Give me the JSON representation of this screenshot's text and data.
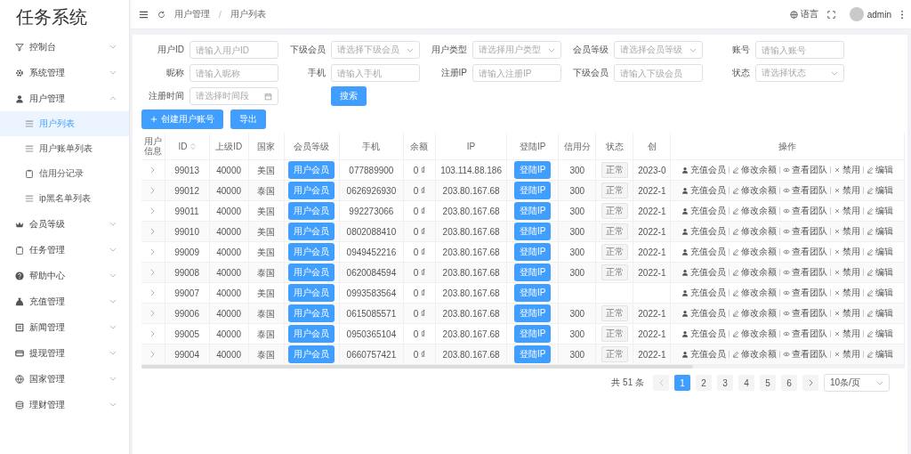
{
  "app_title": "任务系统",
  "sidebar": {
    "items": [
      {
        "label": "控制台",
        "expanded": false,
        "selected": false
      },
      {
        "label": "系统管理",
        "expanded": false,
        "selected": false
      },
      {
        "label": "用户管理",
        "expanded": true,
        "selected": false,
        "children": [
          {
            "label": "用户列表",
            "selected": true
          },
          {
            "label": "用户账单列表",
            "selected": false
          },
          {
            "label": "信用分记录",
            "selected": false
          },
          {
            "label": "ip黑名单列表",
            "selected": false
          }
        ]
      },
      {
        "label": "会员等级",
        "expanded": false,
        "selected": false
      },
      {
        "label": "任务管理",
        "expanded": false,
        "selected": false
      },
      {
        "label": "帮助中心",
        "expanded": false,
        "selected": false
      },
      {
        "label": "充值管理",
        "expanded": false,
        "selected": false
      },
      {
        "label": "新闻管理",
        "expanded": false,
        "selected": false
      },
      {
        "label": "提现管理",
        "expanded": false,
        "selected": false
      },
      {
        "label": "国家管理",
        "expanded": false,
        "selected": false
      },
      {
        "label": "理财管理",
        "expanded": false,
        "selected": false
      }
    ]
  },
  "header": {
    "breadcrumb": [
      "用户管理",
      "用户列表"
    ],
    "separator": "/",
    "language": "语言",
    "user": "admin"
  },
  "filters": [
    {
      "label": "用户ID",
      "placeholder": "请输入用户ID",
      "kind": "input"
    },
    {
      "label": "下级会员",
      "placeholder": "请选择下级会员",
      "kind": "select"
    },
    {
      "label": "用户类型",
      "placeholder": "请选择用户类型",
      "kind": "select"
    },
    {
      "label": "会员等级",
      "placeholder": "请选择会员等级",
      "kind": "select"
    },
    {
      "label": "账号",
      "placeholder": "请输入账号",
      "kind": "input"
    },
    {
      "label": "昵称",
      "placeholder": "请输入昵称",
      "kind": "input"
    },
    {
      "label": "手机",
      "placeholder": "请输入手机",
      "kind": "input"
    },
    {
      "label": "注册IP",
      "placeholder": "请输入注册IP",
      "kind": "input"
    },
    {
      "label": "下级会员",
      "placeholder": "请输入下级会员",
      "kind": "input"
    },
    {
      "label": "状态",
      "placeholder": "请选择状态",
      "kind": "select"
    },
    {
      "label": "注册时间",
      "placeholder": "请选择时间段",
      "kind": "date"
    }
  ],
  "search_button": "搜索",
  "toolbar": [
    "创建用户账号",
    "导出"
  ],
  "table": {
    "columns": [
      {
        "label": "用户信息",
        "sortable": false
      },
      {
        "label": "ID",
        "sortable": true
      },
      {
        "label": "上级ID",
        "sortable": false
      },
      {
        "label": "国家",
        "sortable": false
      },
      {
        "label": "会员等级",
        "sortable": false
      },
      {
        "label": "手机",
        "sortable": false
      },
      {
        "label": "余额",
        "sortable": false
      },
      {
        "label": "IP",
        "sortable": false
      },
      {
        "label": "登陆IP",
        "sortable": false
      },
      {
        "label": "信用分",
        "sortable": false
      },
      {
        "label": "状态",
        "sortable": false
      },
      {
        "label": "创",
        "sortable": false
      },
      {
        "label": "操作",
        "sortable": false
      }
    ],
    "rows": [
      {
        "id": "99013",
        "parent_id": "40000",
        "country": "美国",
        "level": "用户会员",
        "phone": "077889900",
        "balance": "0 ₫",
        "ip": "103.114.88.186",
        "login_ip": "登陆IP",
        "credit": "300",
        "status": "正常",
        "date": "2023-0",
        "actions": [
          "充值会员",
          "修改余额",
          "查看团队",
          "禁用",
          "编辑"
        ]
      },
      {
        "id": "99012",
        "parent_id": "40000",
        "country": "泰国",
        "level": "用户会员",
        "phone": "0626926930",
        "balance": "0 ₫",
        "ip": "203.80.167.68",
        "login_ip": "登陆IP",
        "credit": "300",
        "status": "正常",
        "date": "2022-1",
        "actions": [
          "充值会员",
          "修改余额",
          "查看团队",
          "禁用",
          "编辑"
        ]
      },
      {
        "id": "99011",
        "parent_id": "40000",
        "country": "美国",
        "level": "用户会员",
        "phone": "992273066",
        "balance": "0 ₫",
        "ip": "203.80.167.68",
        "login_ip": "登陆IP",
        "credit": "300",
        "status": "正常",
        "date": "2022-1",
        "actions": [
          "充值会员",
          "修改余额",
          "查看团队",
          "禁用",
          "编辑"
        ]
      },
      {
        "id": "99010",
        "parent_id": "40000",
        "country": "美国",
        "level": "用户会员",
        "phone": "0802088410",
        "balance": "0 ₫",
        "ip": "203.80.167.68",
        "login_ip": "登陆IP",
        "credit": "300",
        "status": "正常",
        "date": "2022-1",
        "actions": [
          "充值会员",
          "修改余额",
          "查看团队",
          "禁用",
          "编辑"
        ]
      },
      {
        "id": "99009",
        "parent_id": "40000",
        "country": "美国",
        "level": "用户会员",
        "phone": "0949452216",
        "balance": "0 ₫",
        "ip": "203.80.167.68",
        "login_ip": "登陆IP",
        "credit": "300",
        "status": "正常",
        "date": "2022-1",
        "actions": [
          "充值会员",
          "修改余额",
          "查看团队",
          "禁用",
          "编辑"
        ]
      },
      {
        "id": "99008",
        "parent_id": "40000",
        "country": "泰国",
        "level": "用户会员",
        "phone": "0620084594",
        "balance": "0 ₫",
        "ip": "203.80.167.68",
        "login_ip": "登陆IP",
        "credit": "300",
        "status": "正常",
        "date": "2022-1",
        "actions": [
          "充值会员",
          "修改余额",
          "查看团队",
          "禁用",
          "编辑"
        ]
      },
      {
        "id": "99007",
        "parent_id": "40000",
        "country": "美国",
        "level": "用户会员",
        "phone": "0993583564",
        "balance": "0 ₫",
        "ip": "203.80.167.68",
        "login_ip": "登陆IP",
        "actions": [
          "充值会员",
          "修改余额",
          "查看团队",
          "禁用",
          "编辑"
        ]
      },
      {
        "id": "99006",
        "parent_id": "40000",
        "country": "泰国",
        "level": "用户会员",
        "phone": "0615085571",
        "balance": "0 ₫",
        "ip": "203.80.167.68",
        "login_ip": "登陆IP",
        "credit": "300",
        "status": "正常",
        "date": "2022-1",
        "actions": [
          "充值会员",
          "修改余额",
          "查看团队",
          "禁用",
          "编辑"
        ]
      },
      {
        "id": "99005",
        "parent_id": "40000",
        "country": "泰国",
        "level": "用户会员",
        "phone": "0950365104",
        "balance": "0 ₫",
        "ip": "203.80.167.68",
        "login_ip": "登陆IP",
        "credit": "300",
        "status": "正常",
        "date": "2022-1",
        "actions": [
          "充值会员",
          "修改余额",
          "查看团队",
          "禁用",
          "编辑"
        ]
      },
      {
        "id": "99004",
        "parent_id": "40000",
        "country": "泰国",
        "level": "用户会员",
        "phone": "0660757421",
        "balance": "0 ₫",
        "ip": "203.80.167.68",
        "login_ip": "登陆IP",
        "credit": "300",
        "status": "正常",
        "date": "2022-1",
        "actions": [
          "充值会员",
          "修改余额",
          "查看团队",
          "禁用",
          "编辑"
        ]
      }
    ]
  },
  "pagination": {
    "total": "共 51 条",
    "pages": [
      {
        "label": "1",
        "selected": true
      },
      {
        "label": "2",
        "selected": false
      },
      {
        "label": "3",
        "selected": false
      },
      {
        "label": "4",
        "selected": false
      },
      {
        "label": "5",
        "selected": false
      },
      {
        "label": "6",
        "selected": false
      }
    ],
    "page_size": "10条/页"
  }
}
